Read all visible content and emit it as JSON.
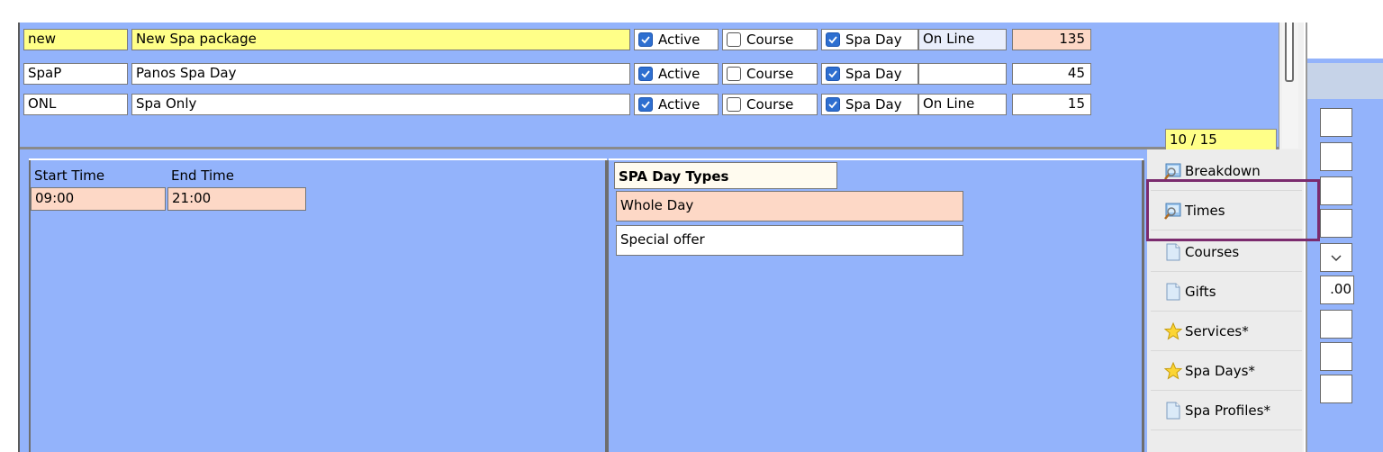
{
  "rows": [
    {
      "code": "new",
      "name": "New Spa package",
      "active": "Active",
      "active_checked": true,
      "course": "Course",
      "course_checked": false,
      "spa_day": "Spa Day",
      "spa_day_checked": true,
      "channel": "On Line",
      "value": "135"
    },
    {
      "code": "SpaP",
      "name": "Panos Spa Day",
      "active": "Active",
      "active_checked": true,
      "course": "Course",
      "course_checked": false,
      "spa_day": "Spa Day",
      "spa_day_checked": true,
      "channel": "",
      "value": "45"
    },
    {
      "code": "ONL",
      "name": "Spa Only",
      "active": "Active",
      "active_checked": true,
      "course": "Course",
      "course_checked": false,
      "spa_day": "Spa Day",
      "spa_day_checked": true,
      "channel": "On Line",
      "value": "15"
    }
  ],
  "counter": "10 / 15",
  "times": {
    "start_label": "Start Time",
    "end_label": "End Time",
    "start_value": "09:00",
    "end_value": "21:00"
  },
  "spa_day_types": {
    "header": "SPA Day Types",
    "items": [
      "Whole Day",
      "Special offer"
    ]
  },
  "side_buttons": [
    {
      "label": "Breakdown",
      "icon": "search-doc-icon"
    },
    {
      "label": "Times",
      "icon": "search-doc-icon"
    },
    {
      "label": "Courses",
      "icon": "document-icon"
    },
    {
      "label": "Gifts",
      "icon": "document-icon"
    },
    {
      "label": "Services*",
      "icon": "star-icon"
    },
    {
      "label": "Spa Days*",
      "icon": "star-icon"
    },
    {
      "label": "Spa Profiles*",
      "icon": "document-icon"
    }
  ],
  "far_right": {
    "partial_value": ".00"
  },
  "colors": {
    "panel_blue": "#93b3fb",
    "highlight_yellow": "#ffff88",
    "peach": "#fdd8c6",
    "checkbox_blue": "#2e6fd0",
    "selection_border": "#7b2b6e"
  }
}
